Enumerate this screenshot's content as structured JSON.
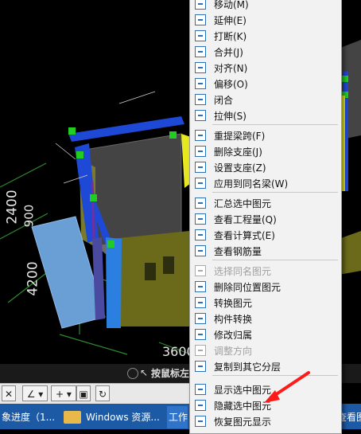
{
  "scene": {
    "dims": [
      "2400",
      "900",
      "4200",
      "3600"
    ]
  },
  "status": {
    "hint": "按鼠标左键"
  },
  "menu": {
    "items": [
      {
        "label": "移动(M)",
        "disabled": false
      },
      {
        "label": "延伸(E)",
        "disabled": false
      },
      {
        "label": "打断(K)",
        "disabled": false
      },
      {
        "label": "合并(J)",
        "disabled": false
      },
      {
        "label": "对齐(N)",
        "disabled": false
      },
      {
        "label": "偏移(O)",
        "disabled": false
      },
      {
        "label": "闭合",
        "disabled": false
      },
      {
        "label": "拉伸(S)",
        "disabled": false
      },
      {
        "label": "重提梁跨(F)",
        "disabled": false
      },
      {
        "label": "删除支座(J)",
        "disabled": false
      },
      {
        "label": "设置支座(Z)",
        "disabled": false
      },
      {
        "label": "应用到同名梁(W)",
        "disabled": false
      },
      {
        "label": "汇总选中图元",
        "disabled": false
      },
      {
        "label": "查看工程量(Q)",
        "disabled": false
      },
      {
        "label": "查看计算式(E)",
        "disabled": false
      },
      {
        "label": "查看钢筋量",
        "disabled": false
      },
      {
        "label": "选择同名图元",
        "disabled": true
      },
      {
        "label": "删除同位置图元",
        "disabled": false
      },
      {
        "label": "转换图元",
        "disabled": false
      },
      {
        "label": "构件转换",
        "disabled": false
      },
      {
        "label": "修改归属",
        "disabled": false
      },
      {
        "label": "调整方向",
        "disabled": true
      },
      {
        "label": "复制到其它分层",
        "disabled": false
      },
      {
        "label": "显示选中图元",
        "disabled": false
      },
      {
        "label": "隐藏选中图元",
        "disabled": false
      },
      {
        "label": "恢复图元显示",
        "disabled": false
      }
    ]
  },
  "taskbar": {
    "items": [
      "象进度（1...",
      "Windows 资源...",
      "工作",
      "查看图"
    ]
  }
}
